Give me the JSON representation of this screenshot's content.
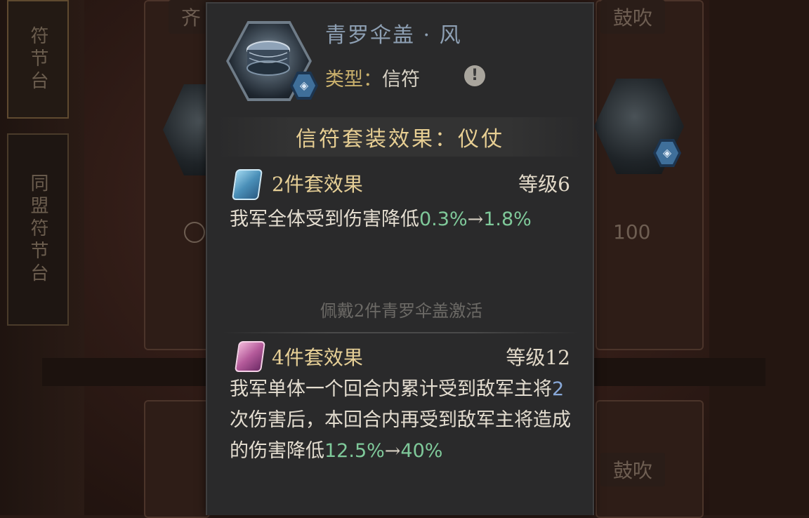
{
  "background": {
    "left_tabs": [
      {
        "label": "符节台"
      },
      {
        "label": "同盟符节台"
      }
    ],
    "top_left_label": "齐",
    "top_right_label": "鼓吹",
    "right_value": "100",
    "bottom_right_label": "鼓吹"
  },
  "tooltip": {
    "item_name": "青罗伞盖 · 风",
    "type_label": "类型：",
    "type_value": "信符",
    "info_icon": "!",
    "set_title": "信符套装效果：仪仗",
    "tier2": {
      "title": "2件套效果",
      "level": "等级6",
      "desc_prefix": "我军全体受到伤害降低",
      "from_value": "0.3%",
      "arrow": "→",
      "to_value": "1.8%",
      "icon": "blue-talisman-icon"
    },
    "activation_hint": "佩戴2件青罗伞盖激活",
    "tier4": {
      "title": "4件套效果",
      "level": "等级12",
      "desc_part1": "我军单体一个回合内累计受到敌军主将",
      "count": "2",
      "desc_part2": "次伤害后，本回合内再受到敌军主将造成的伤害降低",
      "from_value": "12.5%",
      "arrow": "→",
      "to_value": "40%",
      "icon": "purple-talisman-icon"
    }
  },
  "colors": {
    "panel_bg": "#2a2a2b",
    "gold": "#e8cf93",
    "green_value": "#7fc99a",
    "name_blue": "#8ea0b4"
  }
}
